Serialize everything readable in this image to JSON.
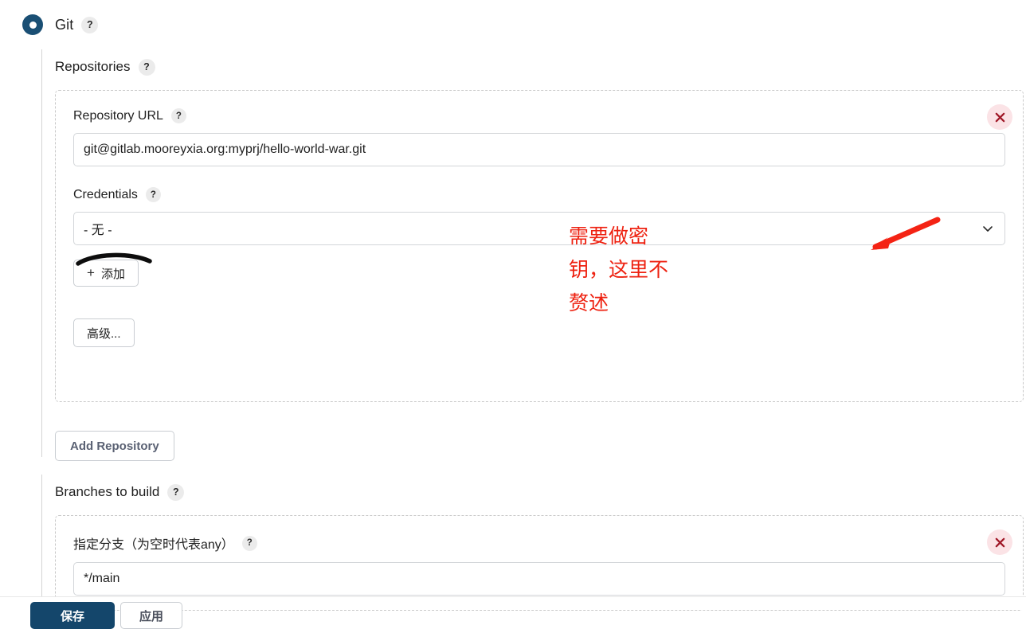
{
  "scm": {
    "selected_label": "Git",
    "help_glyph": "?"
  },
  "repositories": {
    "title": "Repositories",
    "help_glyph": "?",
    "repo_url": {
      "label": "Repository URL",
      "help_glyph": "?",
      "value": "git@gitlab.mooreyxia.org:myprj/hello-world-war.git",
      "placeholder": ""
    },
    "credentials": {
      "label": "Credentials",
      "help_glyph": "?",
      "selected": "- 无 -",
      "options": [
        "- 无 -"
      ],
      "add_button": "添加",
      "add_button_plus": "+"
    },
    "advanced_button": "高级...",
    "delete_title": "×",
    "add_repository_button": "Add Repository"
  },
  "branches": {
    "title": "Branches to build",
    "help_glyph": "?",
    "branch_spec": {
      "label": "指定分支（为空时代表any）",
      "help_glyph": "?",
      "value": "*/main",
      "placeholder": ""
    },
    "delete_title": "×"
  },
  "annotation": {
    "line1": "需要做密",
    "line2": "钥，这里不",
    "line3": "赘述",
    "color": "#ee2211"
  },
  "bottom_bar": {
    "save_label": "保存",
    "apply_label": "应用"
  },
  "colors": {
    "accent": "#14466b",
    "radio": "#1a4f74",
    "annotation_red": "#ee2211",
    "delete_bg": "#fbe3e6",
    "delete_fg": "#a01828"
  }
}
